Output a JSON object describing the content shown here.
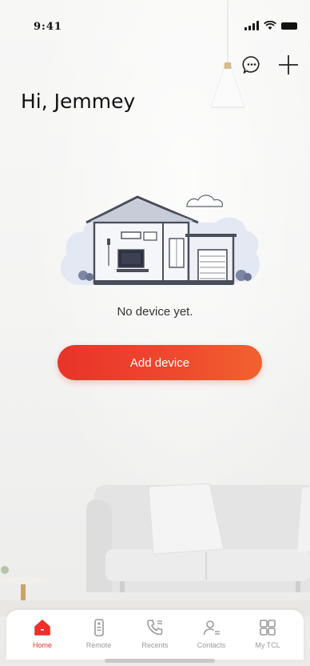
{
  "status_bar": {
    "time": "9:41"
  },
  "header": {
    "greeting": "Hi, Jemmey"
  },
  "top_actions": [
    "message-icon",
    "add-icon"
  ],
  "empty_state": {
    "message": "No device yet."
  },
  "actions": {
    "add_device_label": "Add device"
  },
  "tabs": [
    {
      "label": "Home",
      "icon": "home-icon",
      "active": true
    },
    {
      "label": "Remote",
      "icon": "remote-icon",
      "active": false
    },
    {
      "label": "Recents",
      "icon": "phone-icon",
      "active": false
    },
    {
      "label": "Contacts",
      "icon": "contacts-icon",
      "active": false
    },
    {
      "label": "My TCL",
      "icon": "grid-icon",
      "active": false
    }
  ],
  "colors": {
    "accent": "#e8332a",
    "inactive": "#9a9a9a"
  }
}
